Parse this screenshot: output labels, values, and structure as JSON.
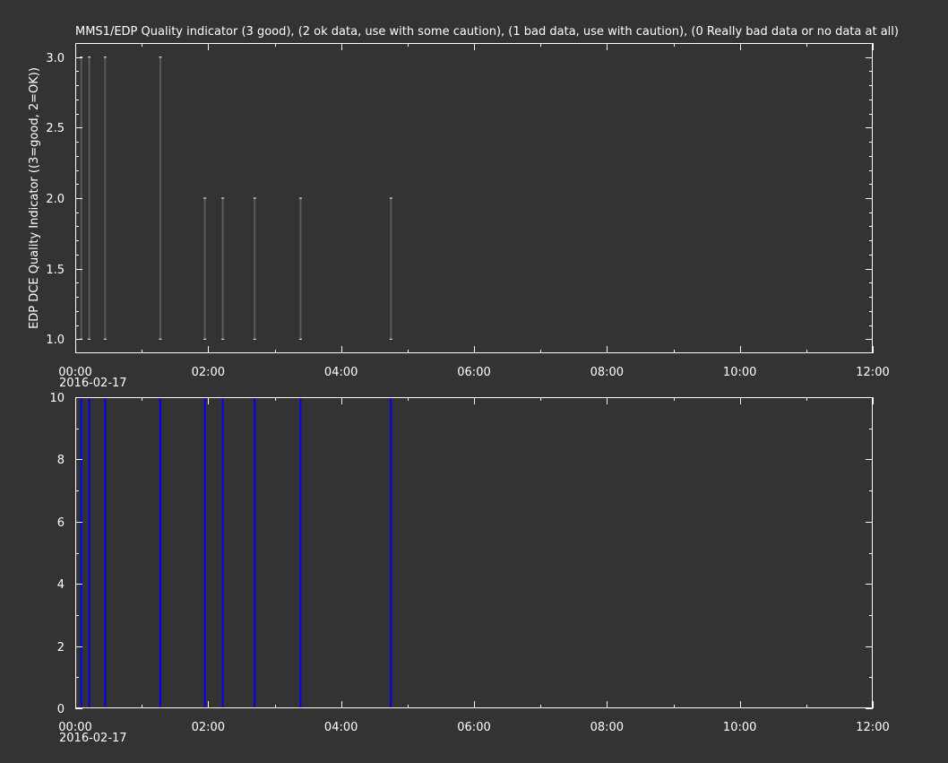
{
  "colors": {
    "background": "#333333",
    "foreground": "#ffffff",
    "panel1_marks": "#5a5a5a",
    "panel2_marks": "#0000ff"
  },
  "chart_data": [
    {
      "type": "line",
      "title": "MMS1/EDP  Quality indicator (3 good), (2 ok data, use with some caution), (1 bad data, use with caution), (0 Really bad data or no data at all)",
      "ylabel": "EDP DCE Quality Indicator ((3=good, 2=OK))",
      "xlabel": "",
      "x_unit": "hours since 2016-02-17 00:00",
      "xlim": [
        0,
        12
      ],
      "ylim": [
        0.9,
        3.1
      ],
      "x_ticks": [
        "00:00",
        "02:00",
        "04:00",
        "06:00",
        "08:00",
        "10:00",
        "12:00"
      ],
      "x_date_label": "2016-02-17",
      "y_ticks": [
        "1.0",
        "1.5",
        "2.0",
        "2.5",
        "3.0"
      ],
      "y_tick_values": [
        1.0,
        1.5,
        2.0,
        2.5,
        3.0
      ],
      "grid": false,
      "events": [
        {
          "x": 0.09,
          "low": 1.0,
          "high": 3.0
        },
        {
          "x": 0.21,
          "low": 1.0,
          "high": 3.0
        },
        {
          "x": 0.45,
          "low": 1.0,
          "high": 3.0
        },
        {
          "x": 1.28,
          "low": 1.0,
          "high": 3.0
        },
        {
          "x": 1.95,
          "low": 1.0,
          "high": 2.0
        },
        {
          "x": 2.22,
          "low": 1.0,
          "high": 2.0
        },
        {
          "x": 2.7,
          "low": 1.0,
          "high": 2.0
        },
        {
          "x": 3.39,
          "low": 1.0,
          "high": 2.0
        },
        {
          "x": 4.75,
          "low": 1.0,
          "high": 2.0
        }
      ]
    },
    {
      "type": "line",
      "title": "",
      "ylabel": "",
      "xlabel": "",
      "xlim": [
        0,
        12
      ],
      "ylim": [
        0,
        10
      ],
      "x_ticks": [
        "00:00",
        "02:00",
        "04:00",
        "06:00",
        "08:00",
        "10:00",
        "12:00"
      ],
      "x_date_label": "2016-02-17",
      "y_ticks": [
        "0",
        "2",
        "4",
        "6",
        "8",
        "10"
      ],
      "y_tick_values": [
        0,
        2,
        4,
        6,
        8,
        10
      ],
      "grid": false,
      "events": [
        {
          "x": 0.09,
          "low": 0,
          "high": 10
        },
        {
          "x": 0.21,
          "low": 0,
          "high": 10
        },
        {
          "x": 0.45,
          "low": 0,
          "high": 10
        },
        {
          "x": 1.28,
          "low": 0,
          "high": 10
        },
        {
          "x": 1.95,
          "low": 0,
          "high": 10
        },
        {
          "x": 2.22,
          "low": 0,
          "high": 10
        },
        {
          "x": 2.7,
          "low": 0,
          "high": 10
        },
        {
          "x": 3.39,
          "low": 0,
          "high": 10
        },
        {
          "x": 4.75,
          "low": 0,
          "high": 10
        }
      ]
    }
  ]
}
